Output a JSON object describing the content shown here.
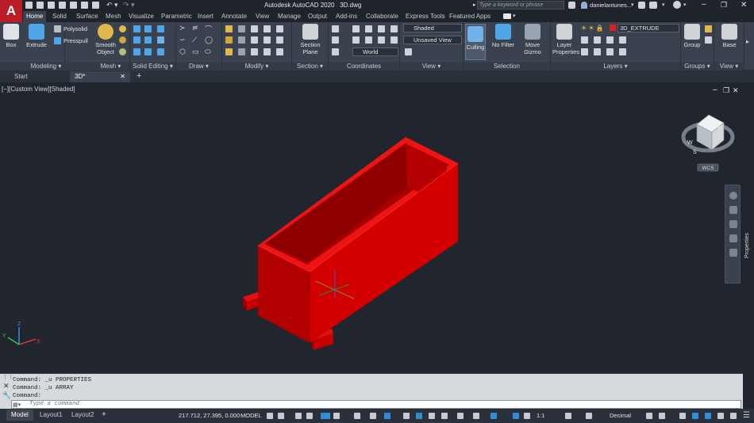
{
  "app": {
    "title": "Autodesk AutoCAD 2020",
    "file": "3D.dwg",
    "search_placeholder": "Type a keyword or phrase",
    "user": "danielantunes...",
    "logo": "A"
  },
  "ribbon_tabs": [
    "Home",
    "Solid",
    "Surface",
    "Mesh",
    "Visualize",
    "Parametric",
    "Insert",
    "Annotate",
    "View",
    "Manage",
    "Output",
    "Add-ins",
    "Collaborate",
    "Express Tools",
    "Featured Apps"
  ],
  "ribbon": {
    "modeling": {
      "title": "Modeling",
      "box": "Box",
      "extrude": "Extrude",
      "polysolid": "Polysolid",
      "presspull": "Presspull"
    },
    "mesh": {
      "title": "Mesh",
      "smooth1": "Smooth",
      "smooth2": "Object"
    },
    "solid_editing": {
      "title": "Solid Editing"
    },
    "draw": {
      "title": "Draw"
    },
    "modify": {
      "title": "Modify"
    },
    "section": {
      "title": "Section",
      "plane1": "Section",
      "plane2": "Plane"
    },
    "coordinates": {
      "title": "Coordinates",
      "ucs": "World"
    },
    "view": {
      "title": "View",
      "visual_style": "Shaded",
      "named_view": "Unsaved View"
    },
    "selection": {
      "title": "Selection",
      "culling": "Culling",
      "nofilter": "No Filter",
      "gizmo1": "Move",
      "gizmo2": "Gizmo"
    },
    "layers": {
      "title": "Layers",
      "props1": "Layer",
      "props2": "Properties",
      "current_layer": "3D_EXTRUDE"
    },
    "groups": {
      "title": "Groups",
      "group": "Group"
    },
    "view2": {
      "title": "View",
      "base": "Base"
    }
  },
  "doc_tabs": [
    "Start",
    "3D*"
  ],
  "viewport": {
    "label": "[−][Custom View][Shaded]",
    "wcs": "WCS",
    "properties": "Properties"
  },
  "command_history": [
    "Command: _u PROPERTIES",
    "Command: _u ARRAY",
    "Command:"
  ],
  "command_placeholder": "Type a command",
  "layout_tabs": [
    "Model",
    "Layout1",
    "Layout2"
  ],
  "status": {
    "coords": "217.712, 27.395, 0.000",
    "space": "MODEL",
    "scale": "1:1",
    "units": "Decimal"
  },
  "colors": {
    "accent": "#2f8fd6",
    "brand": "#bb1d26",
    "object_front": "#b20000",
    "object_right": "#d40000",
    "object_top": "#ee1414"
  }
}
